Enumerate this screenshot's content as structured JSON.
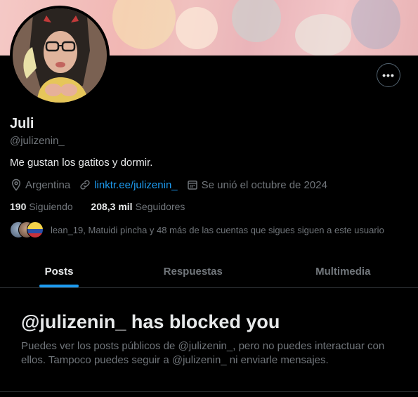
{
  "profile": {
    "name": "Juli",
    "handle": "@julizenin_",
    "bio": "Me gustan los gatitos y dormir.",
    "location": "Argentina",
    "website": "linktr.ee/julizenin_",
    "joined": "Se unió el octubre de 2024",
    "more_button": "•••"
  },
  "counts": {
    "following_number": "190",
    "following_label": "Siguiendo",
    "followers_number": "208,3 mil",
    "followers_label": "Seguidores"
  },
  "followed_by": {
    "text": "lean_19, Matuidi pincha y 48 más de las cuentas que sigues siguen a este usuario"
  },
  "tabs": [
    {
      "label": "Posts",
      "active": true
    },
    {
      "label": "Respuestas",
      "active": false
    },
    {
      "label": "Multimedia",
      "active": false
    }
  ],
  "blocked": {
    "title": "@julizenin_ has blocked you",
    "description": "Puedes ver los posts públicos de @julizenin_, pero no puedes interactuar con ellos. Tampoco puedes seguir a @julizenin_ ni enviarle mensajes."
  },
  "colors": {
    "background": "#000000",
    "text_primary": "#e7e9ea",
    "text_secondary": "#71767b",
    "accent": "#1d9bf0",
    "divider": "#2f3336"
  },
  "icons": {
    "location": "map-pin-icon",
    "website": "link-icon",
    "joined": "calendar-icon",
    "more": "more-horizontal-icon"
  }
}
